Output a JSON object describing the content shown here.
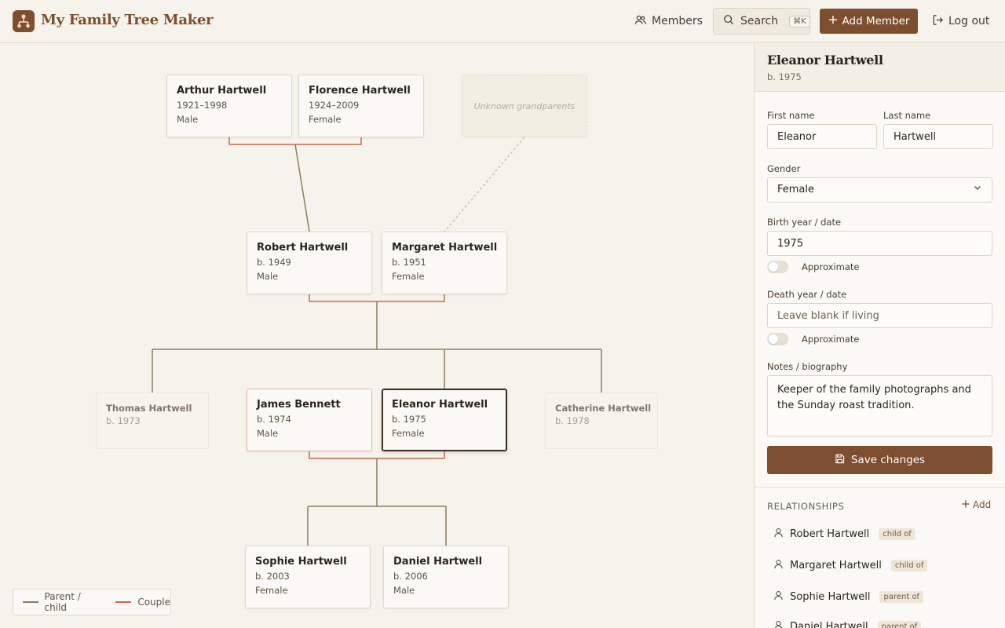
{
  "app": {
    "title": "My Family Tree Maker"
  },
  "header": {
    "members_label": "Members",
    "search_label": "Search",
    "search_shortcut": "⌘K",
    "add_member_label": "Add Member",
    "logout_label": "Log out"
  },
  "tree": {
    "arthur": {
      "name": "Arthur Hartwell",
      "line1": "1921–1998",
      "line2": "Male"
    },
    "florence": {
      "name": "Florence Hartwell",
      "line1": "1924–2009",
      "line2": "Female"
    },
    "unknown": {
      "label": "Unknown grandparents"
    },
    "robert": {
      "name": "Robert Hartwell",
      "line1": "b. 1949",
      "line2": "Male"
    },
    "margaret": {
      "name": "Margaret Hartwell",
      "line1": "b. 1951",
      "line2": "Female"
    },
    "thomas": {
      "name": "Thomas Hartwell",
      "line1": "b. 1973"
    },
    "james": {
      "name": "James Bennett",
      "line1": "b. 1974",
      "line2": "Male"
    },
    "eleanor": {
      "name": "Eleanor Hartwell",
      "line1": "b. 1975",
      "line2": "Female"
    },
    "catherine": {
      "name": "Catherine Hartwell",
      "line1": "b. 1978"
    },
    "sophie": {
      "name": "Sophie Hartwell",
      "line1": "b. 2003",
      "line2": "Female"
    },
    "daniel": {
      "name": "Daniel Hartwell",
      "line1": "b. 2006",
      "line2": "Male"
    }
  },
  "legend": {
    "parent_child": "Parent / child",
    "couple": "Couple"
  },
  "colors": {
    "parent_child": "#8b7d5c",
    "couple": "#c8674c",
    "brand": "#7d4e2f"
  },
  "panel": {
    "name": "Eleanor Hartwell",
    "subtitle": "b. 1975",
    "first_name_label": "First name",
    "first_name_value": "Eleanor",
    "last_name_label": "Last name",
    "last_name_value": "Hartwell",
    "gender_label": "Gender",
    "gender_value": "Female",
    "birth_label": "Birth year / date",
    "birth_value": "1975",
    "approx_label": "Approximate",
    "death_label": "Death year / date",
    "death_placeholder": "Leave blank if living",
    "notes_label": "Notes / biography",
    "notes_value": "Keeper of the family photographs and the Sunday roast tradition.",
    "save_label": "Save changes",
    "relationships_title": "RELATIONSHIPS",
    "relationships_add": "Add",
    "relationships": [
      {
        "name": "Robert Hartwell",
        "tag": "child of"
      },
      {
        "name": "Margaret Hartwell",
        "tag": "child of"
      },
      {
        "name": "Sophie Hartwell",
        "tag": "parent of"
      },
      {
        "name": "Daniel Hartwell",
        "tag": "parent of"
      }
    ]
  }
}
